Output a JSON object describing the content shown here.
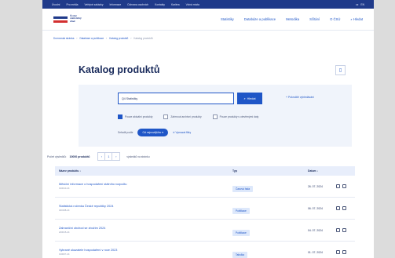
{
  "topbar": {
    "links": [
      "Úvodní",
      "Pro média",
      "Veřejné zakázky",
      "Informace",
      "Ochrana osobních",
      "Kontakty",
      "Kariéra",
      "Volná místa"
    ],
    "lang": [
      "cz",
      "EN"
    ]
  },
  "header": {
    "logo_text": "Český statistický úřad",
    "nav": [
      "Statistiky",
      "Databáze a publikace",
      "Metodika",
      "Sčítání",
      "O ČSÚ",
      "Hledat"
    ]
  },
  "breadcrumb": [
    "Domovská stránka",
    "Databáze a publikace",
    "Katalog produktů",
    "Katalog produktů"
  ],
  "page": {
    "title": "Katalog produktů",
    "view_icon": "grid-view-icon"
  },
  "filter": {
    "search_value": "Q4 Statistiky",
    "search_button": "Hledat",
    "advanced_link": "Pokročilé vyhledávání",
    "checkboxes": [
      {
        "label": "Pouze aktuální produkty",
        "checked": true
      },
      {
        "label": "Zahrnout archivní produkty",
        "checked": false
      },
      {
        "label": "Pouze produkty s otevřenými daty",
        "checked": false
      }
    ],
    "sort_label": "Seřadit podle",
    "sort_value": "Od nejnovějšího",
    "reset_label": "Vymazat filtry"
  },
  "results": {
    "label": "Počet výsledků:",
    "count": "10000 produktů",
    "pager": [
      "‹",
      "1",
      "›"
    ],
    "page_label": "výsledků na stránku"
  },
  "table": {
    "columns": [
      "Název produktu",
      "Typ",
      "Datum",
      ""
    ],
    "rows": [
      {
        "title": "Měsíční informace o hospodaření státního rozpočtu",
        "sub": "010010-24",
        "type": "Časová řada",
        "date": "26. 07. 2024"
      },
      {
        "title": "Statistická ročenka České republiky 2024",
        "sub": "320198-24",
        "type": "Publikace",
        "date": "06. 07. 2024"
      },
      {
        "title": "Zahraniční obchod se zbožím 2024",
        "sub": "220015-24",
        "type": "Publikace",
        "date": "04. 07. 2024"
      },
      {
        "title": "Vybrané ukazatele hospodaření v roce 2023",
        "sub": "130007-24",
        "type": "Tabulka",
        "date": "01. 07. 2024"
      }
    ]
  }
}
